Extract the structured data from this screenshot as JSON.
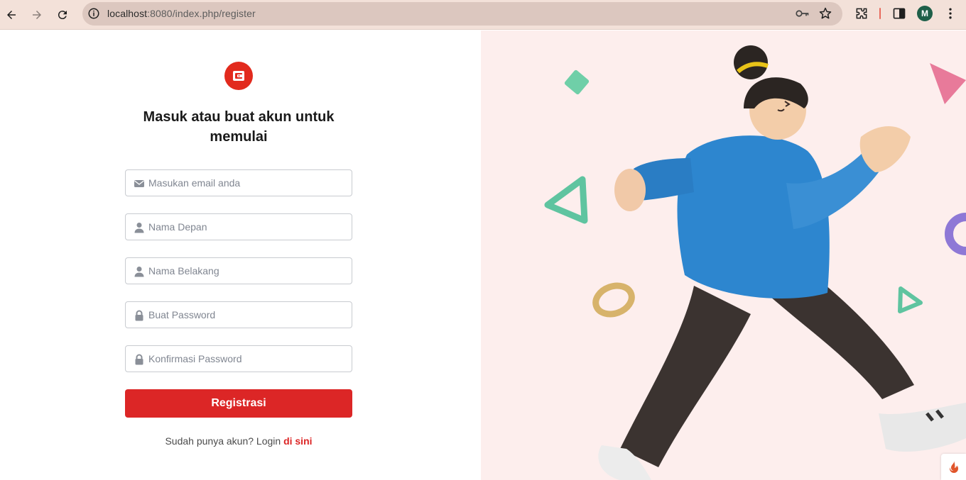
{
  "browser": {
    "url_host": "localhost",
    "url_rest": ":8080/index.php/register",
    "profile_initial": "M"
  },
  "form": {
    "heading": "Masuk atau buat akun untuk memulai",
    "fields": [
      {
        "placeholder": "Masukan email anda",
        "icon": "envelope-icon"
      },
      {
        "placeholder": "Nama Depan",
        "icon": "user-icon"
      },
      {
        "placeholder": "Nama Belakang",
        "icon": "user-icon"
      },
      {
        "placeholder": "Buat Password",
        "icon": "lock-icon"
      },
      {
        "placeholder": "Konfirmasi Password",
        "icon": "lock-icon"
      }
    ],
    "submit_label": "Registrasi",
    "login_prompt": "Sudah punya akun? Login ",
    "login_link": "di sini"
  },
  "colors": {
    "brand": "#dc2626",
    "panel_bg": "#fdeeed",
    "chrome_bg": "#f3e1d9"
  }
}
